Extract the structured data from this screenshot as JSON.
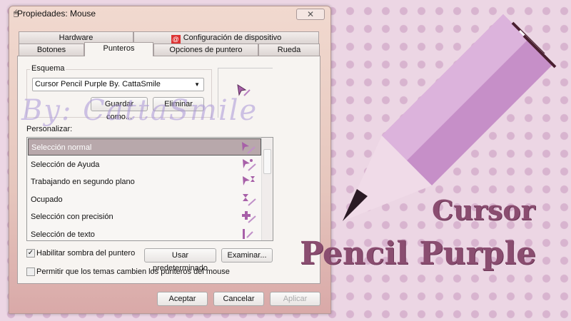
{
  "window": {
    "title": "Propiedades: Mouse",
    "close": "✕"
  },
  "tabs_row1": [
    {
      "label": "Hardware"
    },
    {
      "label": "Configuración de dispositivo"
    }
  ],
  "tabs_row2": [
    {
      "label": "Botones"
    },
    {
      "label": "Punteros"
    },
    {
      "label": "Opciones de puntero"
    },
    {
      "label": "Rueda"
    }
  ],
  "scheme": {
    "legend": "Esquema",
    "selected": "Cursor Pencil Purple By. CattaSmile",
    "save_as": "Guardar como...",
    "delete": "Eliminar"
  },
  "customize": {
    "legend": "Personalizar:",
    "items": [
      {
        "label": "Selección normal",
        "icon": "arrow"
      },
      {
        "label": "Selección de Ayuda",
        "icon": "help"
      },
      {
        "label": "Trabajando en segundo plano",
        "icon": "working"
      },
      {
        "label": "Ocupado",
        "icon": "busy"
      },
      {
        "label": "Selección con precisión",
        "icon": "cross"
      },
      {
        "label": "Selección de texto",
        "icon": "text"
      }
    ],
    "selected_index": 0
  },
  "shadow": {
    "label": "Habilitar sombra del puntero",
    "checked": true
  },
  "themes": {
    "label": "Permitir que los temas cambien los punteros del mouse",
    "checked": false
  },
  "buttons": {
    "default": "Usar predeterminado",
    "browse": "Examinar...",
    "ok": "Aceptar",
    "cancel": "Cancelar",
    "apply": "Aplicar"
  },
  "watermark": "By: CattaSmile",
  "banner": {
    "line1": "Cursor",
    "line2": "Pencil Purple"
  },
  "colors": {
    "accent": "#8a4d70",
    "cursor": "#a760a8"
  }
}
